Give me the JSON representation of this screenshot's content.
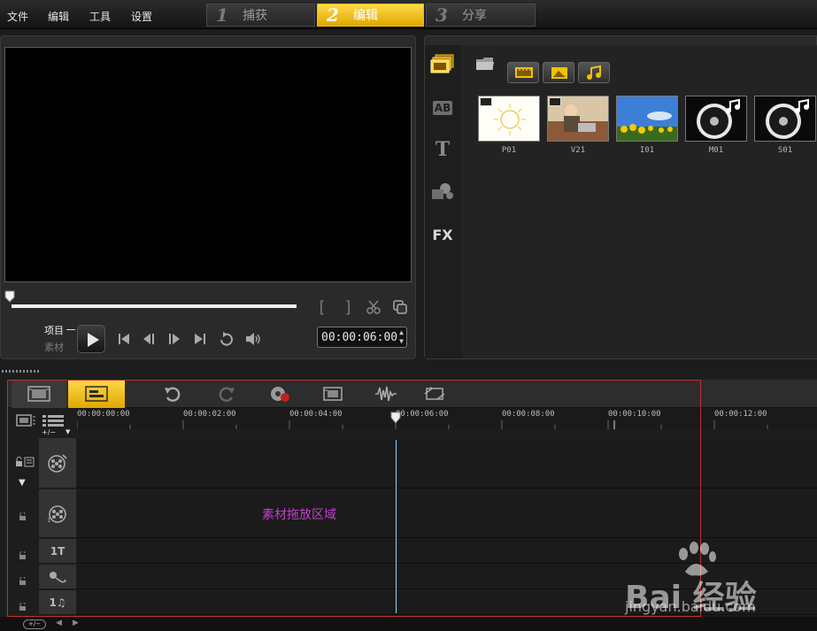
{
  "menu": [
    "文件",
    "编辑",
    "工具",
    "设置"
  ],
  "steps": [
    {
      "num": "1",
      "label": "捕获",
      "active": false
    },
    {
      "num": "2",
      "label": "编辑",
      "active": true
    },
    {
      "num": "3",
      "label": "分享",
      "active": false
    }
  ],
  "player": {
    "mode_project": "项目",
    "mode_clip": "素材",
    "timecode": "00:00:06:00"
  },
  "library": {
    "sidebar": [
      "media-icon",
      "transition-ab-icon",
      "title-t-icon",
      "graphics-icon"
    ],
    "fx_label": "FX",
    "ab_label": "AB",
    "t_label": "T",
    "items": [
      {
        "label": "P01",
        "kind": "sun-drawing"
      },
      {
        "label": "V21",
        "kind": "video-person"
      },
      {
        "label": "I01",
        "kind": "sunflower-field"
      },
      {
        "label": "M01",
        "kind": "audio-disc"
      },
      {
        "label": "S01",
        "kind": "audio-disc"
      }
    ]
  },
  "timeline": {
    "ticks": [
      "00:00:00:00",
      "00:00:02:00",
      "00:00:04:00",
      "00:00:06:00",
      "00:00:08:00",
      "00:00:10:00",
      "00:00:12:00"
    ],
    "track_add_label": "+/−",
    "title_track_label": "1T",
    "music_track_label": "1♫",
    "drop_zone": "素材拖放区域"
  },
  "watermark": {
    "brand": "Bai 经验",
    "url": "jingyan.baidu.com"
  },
  "colors": {
    "active_tab": "#f0c000",
    "drop_zone_text": "#c040c8",
    "playhead": "#9bd3ff",
    "highlight_border": "#c03030"
  }
}
